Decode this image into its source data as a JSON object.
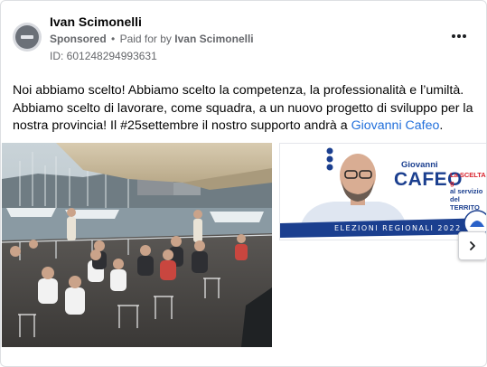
{
  "post": {
    "page_name": "Ivan Scimonelli",
    "sponsored_label": "Sponsored",
    "separator": "•",
    "paid_for_prefix": "Paid for by",
    "paid_for_name": "Ivan Scimonelli",
    "ad_id": "ID: 601248294993631",
    "more_options_icon": "more-horizontal-icon"
  },
  "body": {
    "text_before_link": "Noi abbiamo scelto! Abbiamo scelto la competenza, la professionalità e l’umiltà. Abbiamo scelto di lavorare, come squadra, a un nuovo progetto di sviluppo per la nostra provincia! Il #25settembre il nostro supporto andrà a ",
    "link_text": "Giovanni Cafeo",
    "text_after_link": ".",
    "link_color": "#216fdb"
  },
  "carousel": {
    "slide2": {
      "first_name": "Giovanni",
      "last_name": "CAFEO",
      "tagline_1": "La SCELTA g",
      "tagline_2": "al servizio",
      "tagline_3": "del TERRITO",
      "banner_text": "ELEZIONI REGIONALI 2022",
      "brand_color": "#1b3f8f"
    },
    "next_icon": "chevron-right-icon"
  }
}
